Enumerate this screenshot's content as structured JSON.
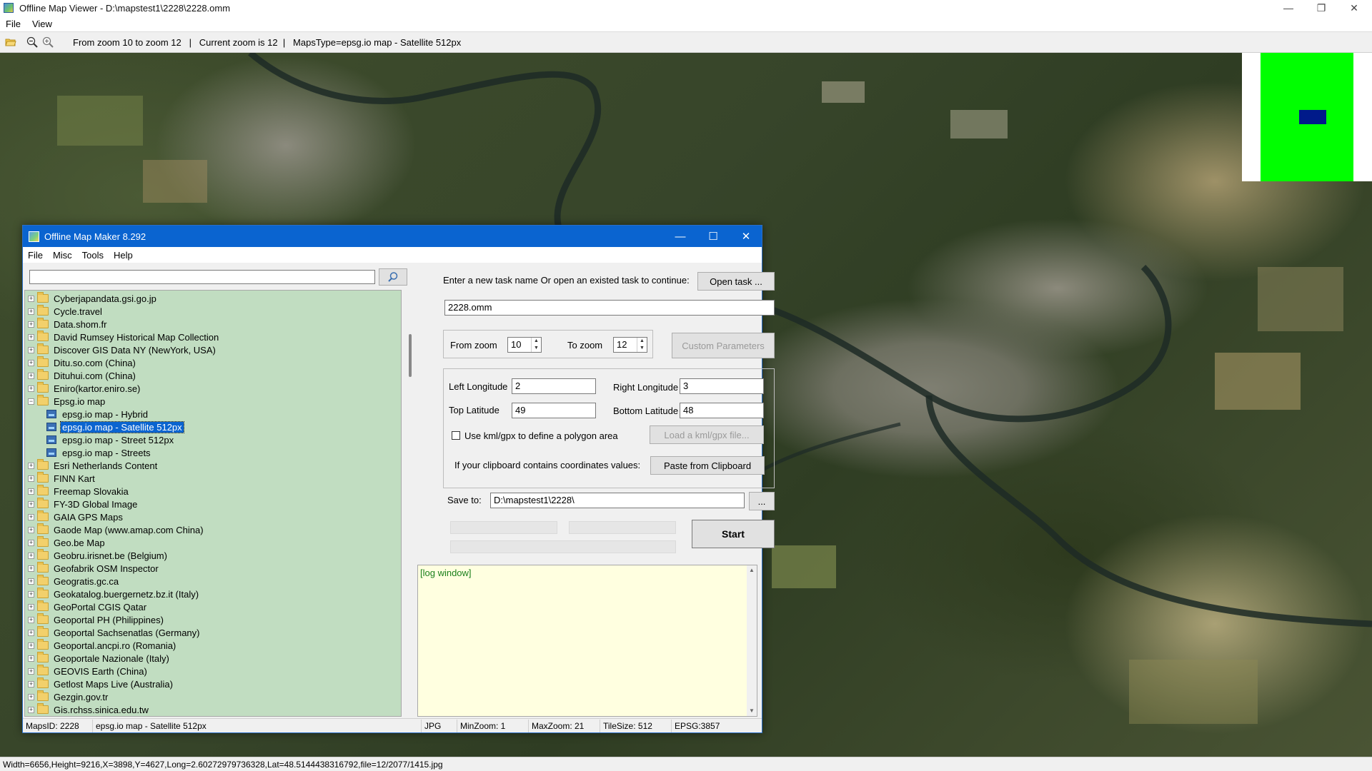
{
  "viewer": {
    "title": "Offline Map Viewer - D:\\mapstest1\\2228\\2228.omm",
    "menu": [
      "File",
      "View"
    ],
    "toolbar_info": "From zoom 10 to zoom 12   |   Current zoom is 12  |   MapsType=epsg.io map - Satellite 512px",
    "status": "Width=6656,Height=9216,X=3898,Y=4627,Long=2.60272979736328,Lat=48.5144438316792,file=12/2077/1415.jpg",
    "icons": [
      "open-folder-icon",
      "zoom-out-icon",
      "zoom-in-icon",
      "minimize-icon",
      "restore-icon",
      "close-icon"
    ],
    "overview_colors": {
      "frame": "#00ff00",
      "viewport": "#001a8a"
    }
  },
  "maker": {
    "title": "Offline Map Maker 8.292",
    "menu": [
      "File",
      "Misc",
      "Tools",
      "Help"
    ],
    "search": {
      "value": "",
      "placeholder": ""
    },
    "tree": [
      {
        "label": "Cyberjapandata.gsi.go.jp",
        "type": "folder",
        "expander": "+"
      },
      {
        "label": "Cycle.travel",
        "type": "folder",
        "expander": "+"
      },
      {
        "label": "Data.shom.fr",
        "type": "folder",
        "expander": "+"
      },
      {
        "label": "David Rumsey Historical Map Collection",
        "type": "folder",
        "expander": "+"
      },
      {
        "label": "Discover GIS Data NY (NewYork, USA)",
        "type": "folder",
        "expander": "+"
      },
      {
        "label": "Ditu.so.com (China)",
        "type": "folder",
        "expander": "+"
      },
      {
        "label": "Dituhui.com (China)",
        "type": "folder",
        "expander": "+"
      },
      {
        "label": "Eniro(kartor.eniro.se)",
        "type": "folder",
        "expander": "+"
      },
      {
        "label": "Epsg.io map",
        "type": "folder",
        "expander": "−"
      },
      {
        "label": "epsg.io map - Hybrid",
        "type": "map",
        "child": true
      },
      {
        "label": "epsg.io map - Satellite 512px",
        "type": "map",
        "child": true,
        "selected": true
      },
      {
        "label": "epsg.io map - Street 512px",
        "type": "map",
        "child": true
      },
      {
        "label": "epsg.io map - Streets",
        "type": "map",
        "child": true
      },
      {
        "label": "Esri Netherlands Content",
        "type": "folder",
        "expander": "+"
      },
      {
        "label": "FINN Kart",
        "type": "folder",
        "expander": "+"
      },
      {
        "label": "Freemap Slovakia",
        "type": "folder",
        "expander": "+"
      },
      {
        "label": "FY-3D Global Image",
        "type": "folder",
        "expander": "+"
      },
      {
        "label": "GAIA GPS Maps",
        "type": "folder",
        "expander": "+"
      },
      {
        "label": "Gaode Map (www.amap.com China)",
        "type": "folder",
        "expander": "+"
      },
      {
        "label": "Geo.be Map",
        "type": "folder",
        "expander": "+"
      },
      {
        "label": "Geobru.irisnet.be (Belgium)",
        "type": "folder",
        "expander": "+"
      },
      {
        "label": "Geofabrik OSM Inspector",
        "type": "folder",
        "expander": "+"
      },
      {
        "label": "Geogratis.gc.ca",
        "type": "folder",
        "expander": "+"
      },
      {
        "label": "Geokatalog.buergernetz.bz.it (Italy)",
        "type": "folder",
        "expander": "+"
      },
      {
        "label": "GeoPortal CGIS Qatar",
        "type": "folder",
        "expander": "+"
      },
      {
        "label": "Geoportal PH (Philippines)",
        "type": "folder",
        "expander": "+"
      },
      {
        "label": "Geoportal Sachsenatlas (Germany)",
        "type": "folder",
        "expander": "+"
      },
      {
        "label": "Geoportal.ancpi.ro (Romania)",
        "type": "folder",
        "expander": "+"
      },
      {
        "label": "Geoportale Nazionale (Italy)",
        "type": "folder",
        "expander": "+"
      },
      {
        "label": "GEOVIS Earth (China)",
        "type": "folder",
        "expander": "+"
      },
      {
        "label": "Getlost Maps Live (Australia)",
        "type": "folder",
        "expander": "+"
      },
      {
        "label": "Gezgin.gov.tr",
        "type": "folder",
        "expander": "+"
      },
      {
        "label": "Gis.rchss.sinica.edu.tw",
        "type": "folder",
        "expander": "+"
      }
    ],
    "task": {
      "prompt": "Enter a new task name Or open an existed task to continue:",
      "open_btn": "Open task ...",
      "name_value": "2228.omm"
    },
    "zoom": {
      "from_label": "From zoom",
      "from_value": "10",
      "to_label": "To zoom",
      "to_value": "12",
      "custom_btn": "Custom Parameters"
    },
    "coords": {
      "left_lon_label": "Left Longitude",
      "left_lon": "2",
      "right_lon_label": "Right Longitude",
      "right_lon": "3",
      "top_lat_label": "Top Latitude",
      "top_lat": "49",
      "bottom_lat_label": "Bottom Latitude",
      "bottom_lat": "48",
      "kml_label": "Use kml/gpx to define a polygon area",
      "kml_btn": "Load a kml/gpx file...",
      "clipboard_label": "If your clipboard contains coordinates values:",
      "clipboard_btn": "Paste from Clipboard"
    },
    "save": {
      "label": "Save to:",
      "value": "D:\\mapstest1\\2228\\",
      "browse_btn": "..."
    },
    "start_btn": "Start",
    "log_text": "[log window]",
    "status": {
      "maps_id": "MapsID: 2228",
      "map_name": "epsg.io map - Satellite 512px",
      "format": "JPG",
      "min_zoom": "MinZoom: 1",
      "max_zoom": "MaxZoom: 21",
      "tile_size": "TileSize: 512",
      "epsg": "EPSG:3857"
    }
  }
}
